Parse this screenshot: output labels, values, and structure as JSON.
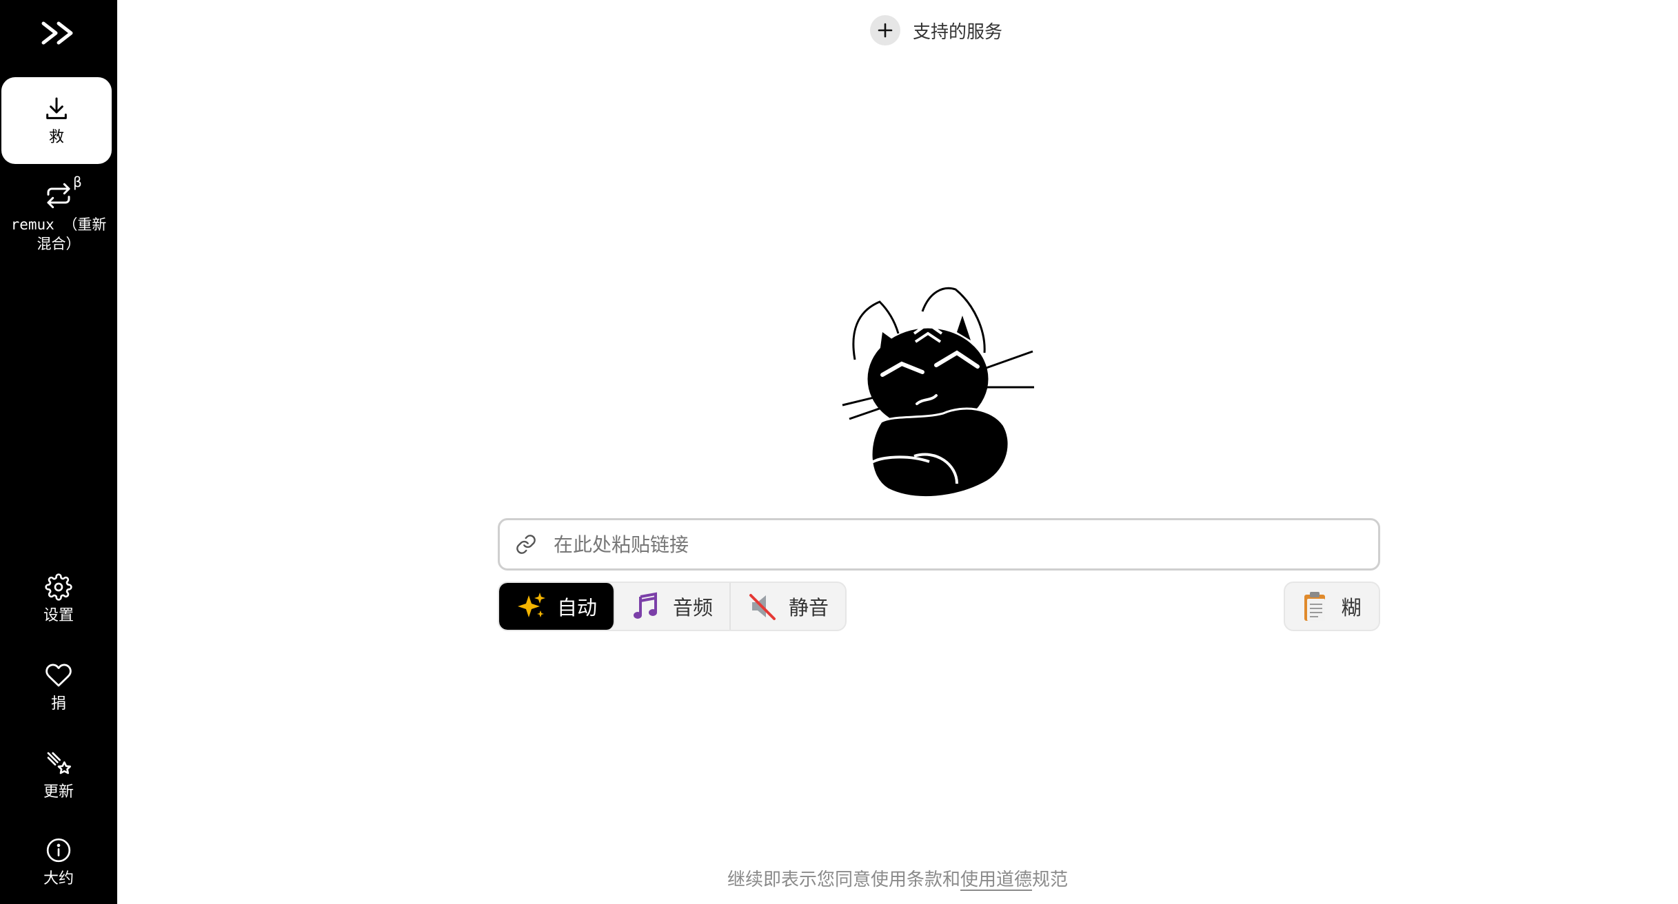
{
  "sidebar": {
    "logo": "logo-icon",
    "items": [
      {
        "label": "救",
        "icon": "download-icon",
        "active": true
      },
      {
        "label": "remux （重新混合）",
        "icon": "repeat-icon",
        "badge": "β"
      },
      {
        "label": "设置",
        "icon": "gear-icon"
      },
      {
        "label": "捐",
        "icon": "heart-icon"
      },
      {
        "label": "更新",
        "icon": "sparkle-icon"
      },
      {
        "label": "大约",
        "icon": "info-icon"
      }
    ]
  },
  "header": {
    "services_label": "支持的服务"
  },
  "input": {
    "placeholder": "在此处粘贴链接"
  },
  "modes": [
    {
      "label": "自动",
      "icon": "sparkles-emoji",
      "active": true
    },
    {
      "label": "音频",
      "icon": "music-notes-emoji"
    },
    {
      "label": "静音",
      "icon": "muted-speaker-emoji"
    }
  ],
  "paste": {
    "label": "糊",
    "icon": "clipboard-emoji"
  },
  "footer": {
    "prefix": "继续即表示您同意使用",
    "terms": "条款",
    "and": "和",
    "ethics": "使用道德",
    "suffix": "规范"
  },
  "colors": {
    "sidebar_bg": "#000000",
    "accent": "#000000",
    "muted_text": "#8a8a8a"
  }
}
